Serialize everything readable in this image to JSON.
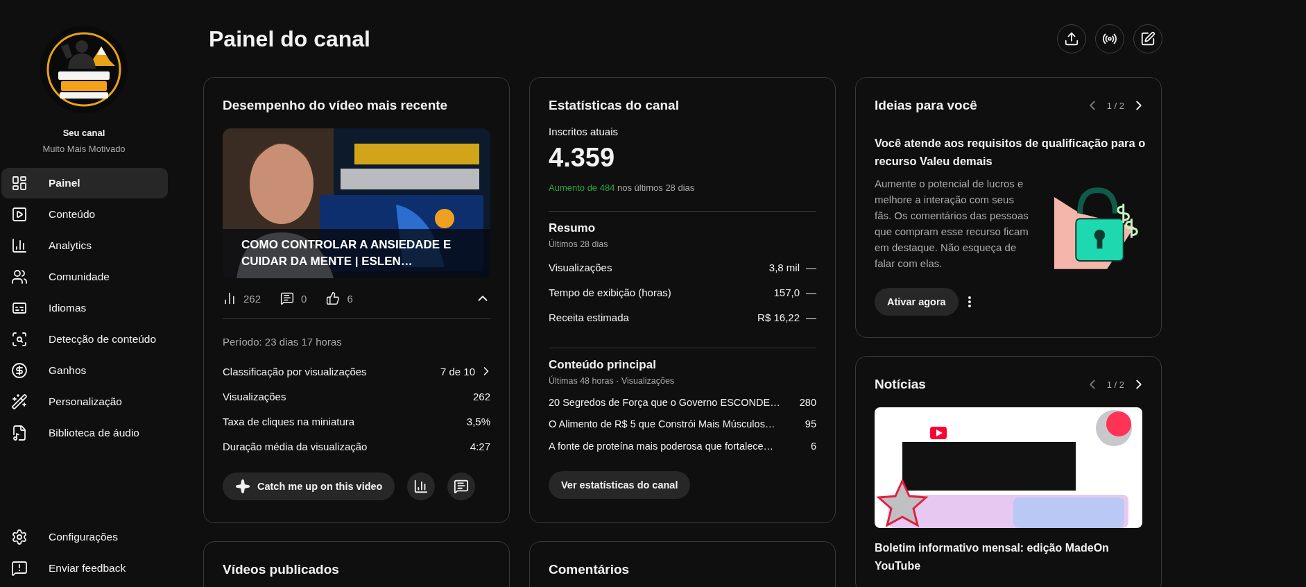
{
  "sidebar": {
    "channel_label": "Seu canal",
    "channel_name": "Muito Mais Motivado",
    "items": [
      {
        "label": "Painel",
        "kind": "dashboard",
        "selected": true
      },
      {
        "label": "Conteúdo",
        "kind": "content",
        "selected": false
      },
      {
        "label": "Analytics",
        "kind": "analytics",
        "selected": false
      },
      {
        "label": "Comunidade",
        "kind": "community",
        "selected": false
      },
      {
        "label": "Idiomas",
        "kind": "subtitles",
        "selected": false
      },
      {
        "label": "Detecção de conteúdo",
        "kind": "detection",
        "selected": false
      },
      {
        "label": "Ganhos",
        "kind": "earn",
        "selected": false
      },
      {
        "label": "Personalização",
        "kind": "customize",
        "selected": false
      },
      {
        "label": "Biblioteca de áudio",
        "kind": "audio",
        "selected": false
      }
    ],
    "footer_items": [
      {
        "label": "Configurações",
        "kind": "settings"
      },
      {
        "label": "Enviar feedback",
        "kind": "feedback"
      }
    ]
  },
  "header": {
    "title": "Painel do canal",
    "actions": [
      {
        "kind": "upload"
      },
      {
        "kind": "live"
      },
      {
        "kind": "edit"
      }
    ]
  },
  "latest_video": {
    "title": "Desempenho do vídeo mais recente",
    "video_title": "COMO CONTROLAR A ANSIEDADE E CUIDAR DA MENTE | ESLEN…",
    "stats": [
      {
        "kind": "views",
        "value": "262"
      },
      {
        "kind": "comments",
        "value": "0"
      },
      {
        "kind": "likes",
        "value": "6"
      }
    ],
    "expanded": true,
    "period": "Período: 23 dias 17 horas",
    "metrics": [
      {
        "label": "Classificação por visualizações",
        "value": "7 de 10",
        "link": true
      },
      {
        "label": "Visualizações",
        "value": "262",
        "link": false
      },
      {
        "label": "Taxa de cliques na miniatura",
        "value": "3,5%",
        "link": false
      },
      {
        "label": "Duração média da visualização",
        "value": "4:27",
        "link": false
      }
    ],
    "catch_up_button": "Catch me up on this video"
  },
  "channel_stats": {
    "title": "Estatísticas do canal",
    "subscribers_label": "Inscritos atuais",
    "subscribers": "4.359",
    "growth_highlight": "Aumento de 484",
    "growth_rest": "nos últimos 28 dias",
    "summary": {
      "title": "Resumo",
      "subtitle": "Últimos 28 dias",
      "rows": [
        {
          "label": "Visualizações",
          "value": "3,8 mil",
          "trend": "—"
        },
        {
          "label": "Tempo de exibição (horas)",
          "value": "157,0",
          "trend": "—"
        },
        {
          "label": "Receita estimada",
          "value": "R$ 16,22",
          "trend": "—"
        }
      ]
    },
    "top_content": {
      "title": "Conteúdo principal",
      "subtitle": "Últimas 48 horas · Visualizações",
      "rows": [
        {
          "title": "20 Segredos de Força que o Governo ESCONDE…",
          "views": "280"
        },
        {
          "title": "O Alimento de R$ 5 que Constrói Mais Músculos…",
          "views": "95"
        },
        {
          "title": "A fonte de proteína mais poderosa que fortalece…",
          "views": "6"
        }
      ]
    },
    "button": "Ver estatísticas do canal"
  },
  "ideas": {
    "title": "Ideias para você",
    "pager": "1 / 2",
    "heading": "Você atende aos requisitos de qualificação para o recurso Valeu demais",
    "body": "Aumente o potencial de lucros e melhore a interação com seus fãs. Os comentários das pessoas que compram esse recurso ficam em destaque. Não esqueça de falar com elas.",
    "button": "Ativar agora"
  },
  "news": {
    "title": "Notícias",
    "pager": "1 / 2",
    "caption": "Boletim informativo mensal: edição MadeOn YouTube"
  },
  "lower_cards": [
    {
      "title": "Vídeos publicados"
    },
    {
      "title": "Comentários"
    }
  ]
}
